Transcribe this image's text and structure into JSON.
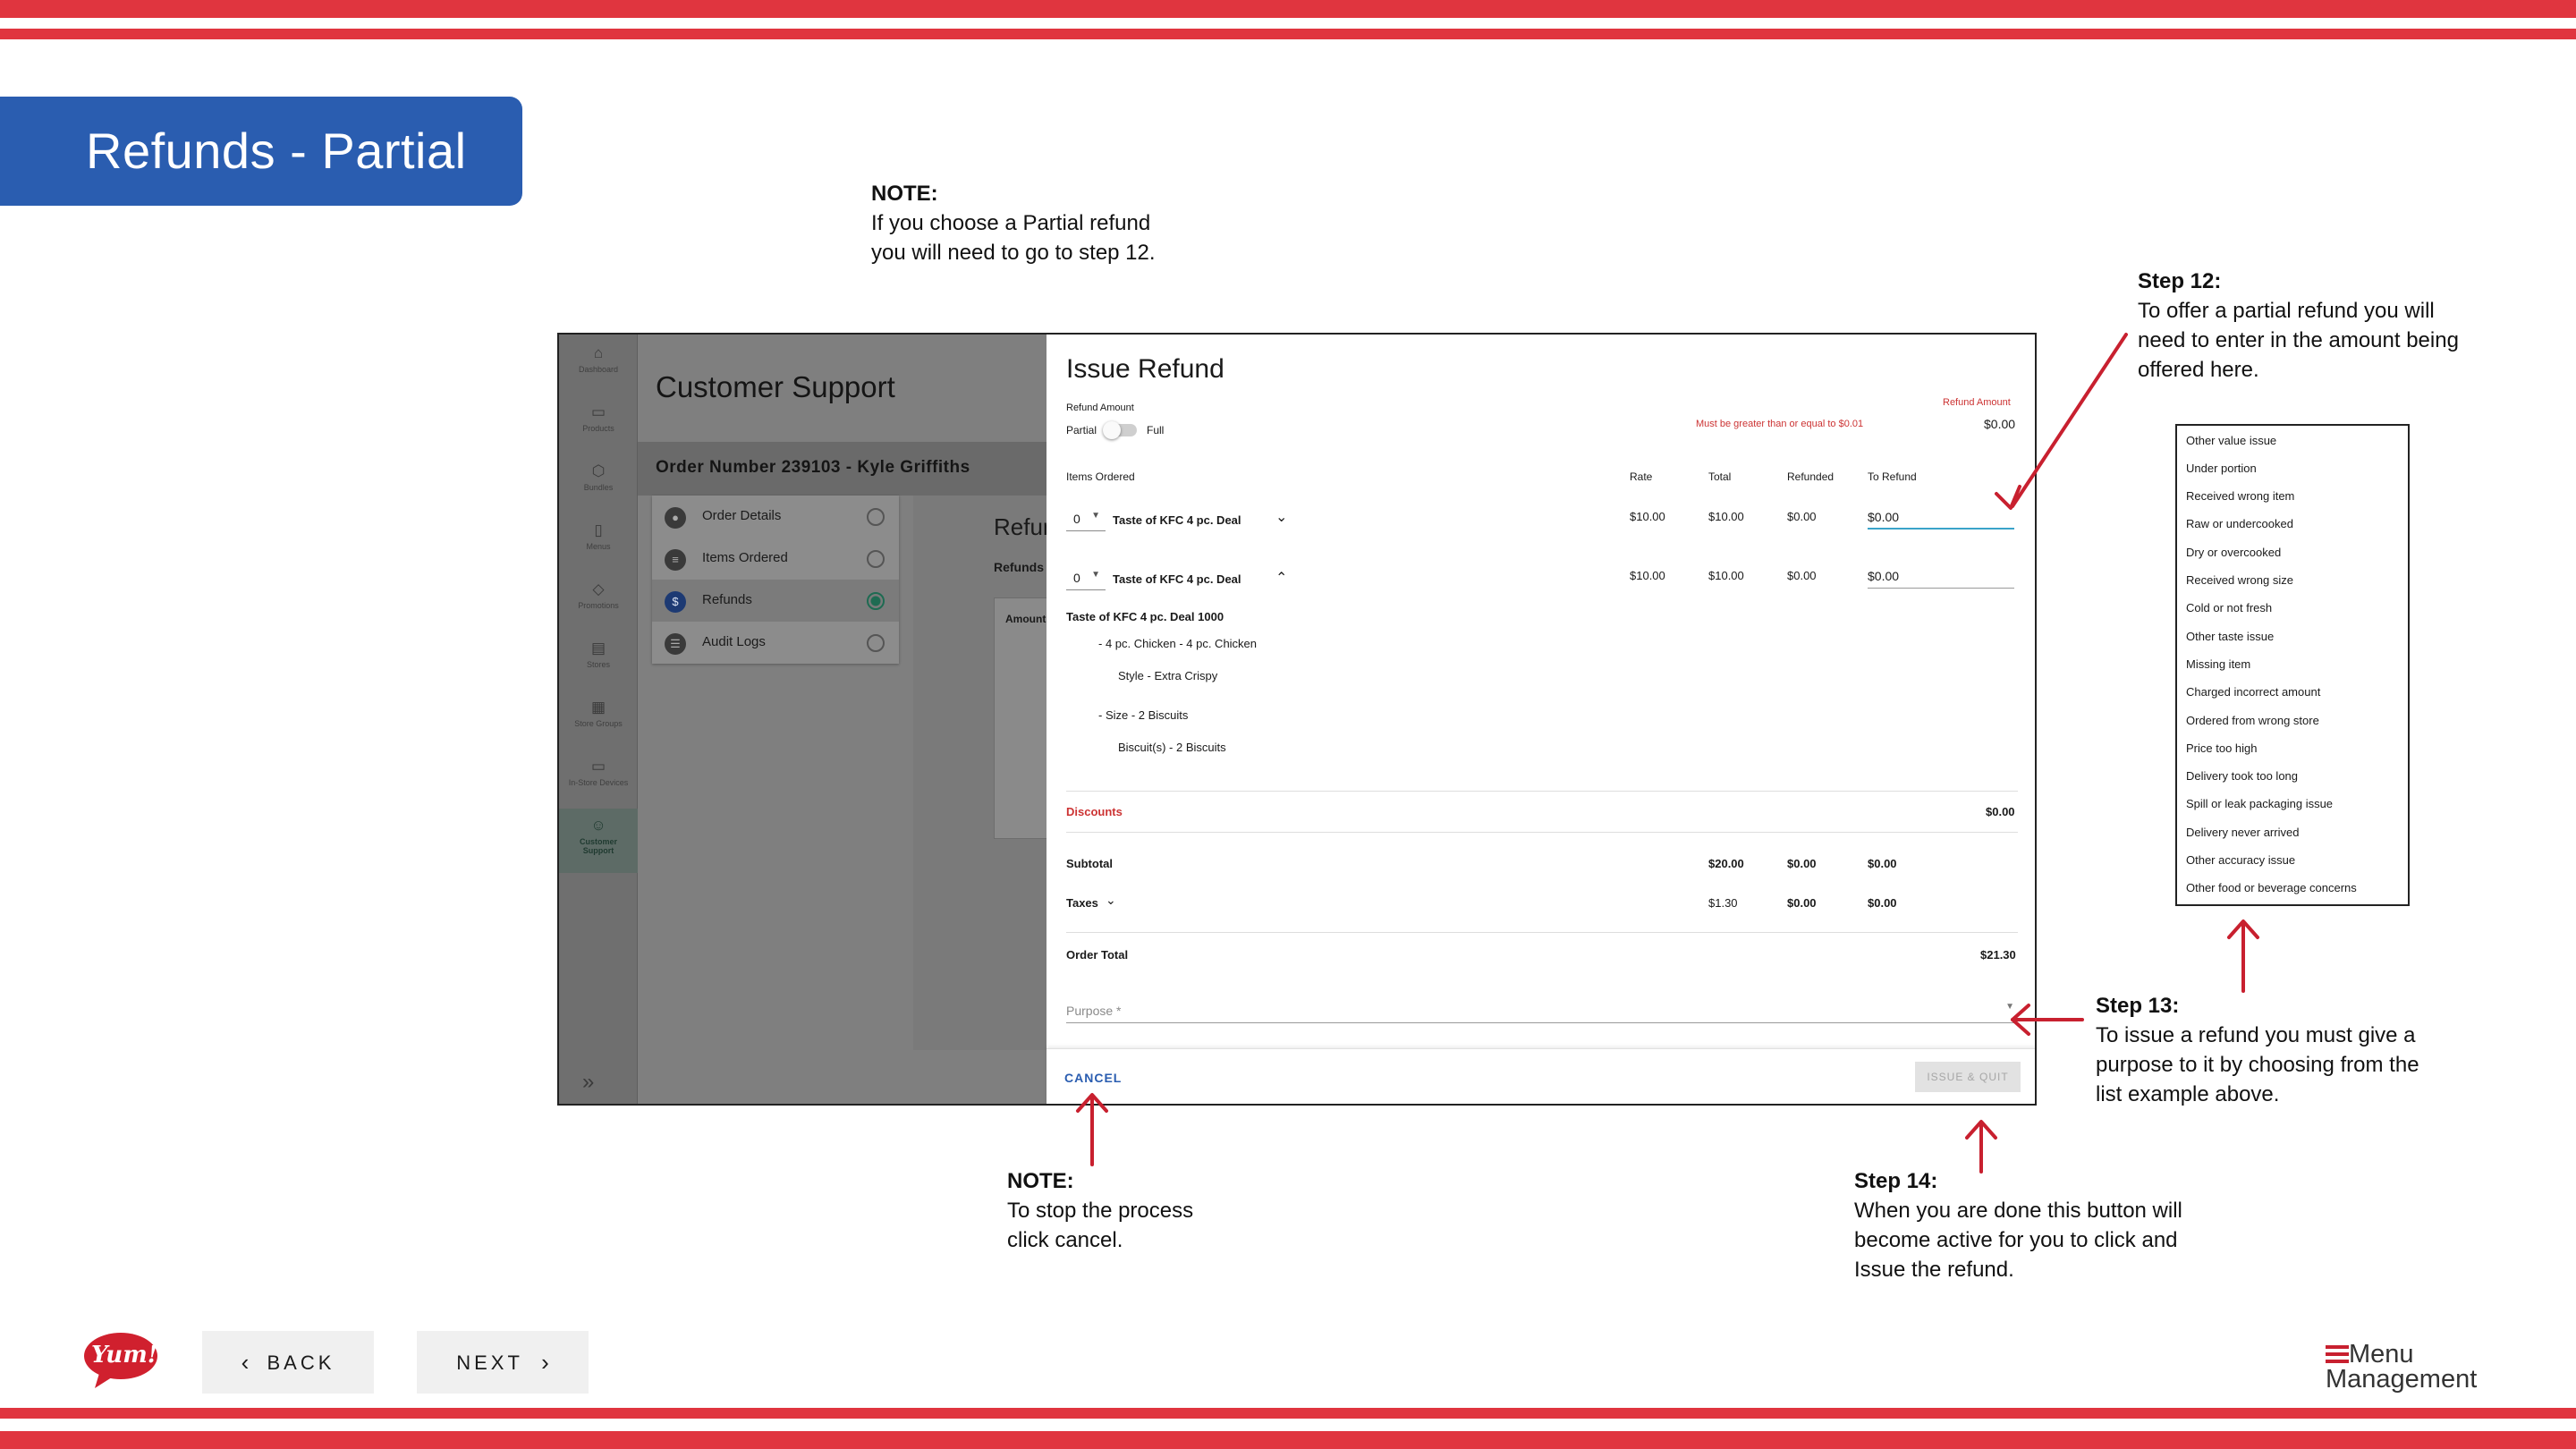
{
  "slide": {
    "title": "Refunds - Partial",
    "note_top": {
      "heading": "NOTE:",
      "line1": "If you choose a Partial refund",
      "line2": "you will need to go to step 12."
    },
    "step12": {
      "heading": "Step 12:",
      "line1": "To offer a partial refund you will",
      "line2": "need to enter in the amount being",
      "line3": "offered here."
    },
    "step13": {
      "heading": "Step 13:",
      "line1": "To issue a refund you must give a",
      "line2": "purpose to it by choosing from the",
      "line3": "list example above."
    },
    "step14": {
      "heading": "Step 14:",
      "line1": "When you are done this button will",
      "line2": "become active for you to click and",
      "line3": "Issue the refund."
    },
    "note_cancel": {
      "heading": "NOTE:",
      "line1": "To stop the process",
      "line2": "click cancel."
    },
    "back_label": "BACK",
    "next_label": "NEXT",
    "brand_left": "Yum!",
    "brand_right_line1": "Menu",
    "brand_right_line2": "Management",
    "colors": {
      "stripe": "#e0353f",
      "title_tab": "#2a5db0",
      "accent_red": "#c8202f"
    }
  },
  "app": {
    "nav": [
      "Dashboard",
      "Products",
      "Bundles",
      "Menus",
      "Promotions",
      "Stores",
      "Store Groups",
      "In-Store Devices",
      "Customer Support"
    ],
    "page_title": "Customer Support",
    "order_header": "Order Number 239103 - Kyle Griffiths",
    "steps": [
      "Order Details",
      "Items Ordered",
      "Refunds",
      "Audit Logs"
    ],
    "bg_panel_title": "Refun",
    "bg_panel_sub": "Refunds",
    "bg_table_header": "Amount"
  },
  "dialog": {
    "title": "Issue Refund",
    "refund_amount_label": "Refund Amount",
    "toggle_partial": "Partial",
    "toggle_full": "Full",
    "validation": "Must be greater than or equal to $0.01",
    "refund_amount_right_label": "Refund Amount",
    "refund_amount_value": "$0.00",
    "columns": {
      "items": "Items Ordered",
      "rate": "Rate",
      "total": "Total",
      "refunded": "Refunded",
      "to_refund": "To Refund"
    },
    "items": [
      {
        "qty": "0",
        "name": "Taste of KFC 4 pc. Deal",
        "rate": "$10.00",
        "total": "$10.00",
        "refunded": "$0.00",
        "to_refund": "$0.00"
      },
      {
        "qty": "0",
        "name": "Taste of KFC 4 pc. Deal",
        "rate": "$10.00",
        "total": "$10.00",
        "refunded": "$0.00",
        "to_refund": "$0.00"
      }
    ],
    "detail": {
      "title": "Taste of KFC 4 pc. Deal 1000",
      "line1": "- 4 pc. Chicken - 4 pc. Chicken",
      "line2": "Style - Extra Crispy",
      "line3": "- Size - 2 Biscuits",
      "line4": "Biscuit(s) - 2 Biscuits"
    },
    "discounts_label": "Discounts",
    "discounts_value": "$0.00",
    "subtotal": {
      "label": "Subtotal",
      "total": "$20.00",
      "refunded": "$0.00",
      "to_refund": "$0.00"
    },
    "taxes": {
      "label": "Taxes",
      "total": "$1.30",
      "refunded": "$0.00",
      "to_refund": "$0.00"
    },
    "order_total_label": "Order Total",
    "order_total_value": "$21.30",
    "purpose_label": "Purpose *",
    "cancel_label": "CANCEL",
    "issue_label": "ISSUE & QUIT"
  },
  "purpose_options": [
    "Other value issue",
    "Under portion",
    "Received wrong item",
    "Raw or undercooked",
    "Dry or overcooked",
    "Received wrong size",
    "Cold or not fresh",
    "Other taste issue",
    "Missing item",
    "Charged incorrect amount",
    "Ordered from wrong store",
    "Price too high",
    "Delivery took too long",
    "Spill or leak packaging issue",
    "Delivery never arrived",
    "Other accuracy issue",
    "Other food or beverage concerns"
  ]
}
